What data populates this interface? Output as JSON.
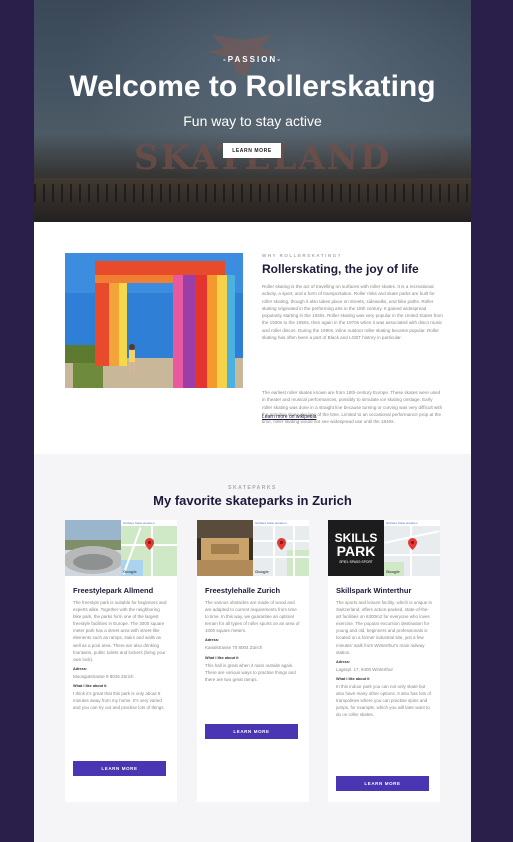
{
  "hero": {
    "kicker": "-PASSION-",
    "title": "Welcome to Rollerskating",
    "subtitle": "Fun way to stay active",
    "button_label": "LEARN MORE",
    "sign_text": "SKATELAND"
  },
  "about": {
    "kicker": "WHY ROLLERSKATING?",
    "title": "Rollerskating, the joy of life",
    "paragraph1": "Roller skating is the act of travelling on surfaces with roller skates. It is a recreational activity, a sport, and a form of transportation. Roller rinks and skate parks are built for roller skating, though it also takes place on streets, sidewalks, and bike paths. Roller skating originated in the performing arts in the 18th century. It gained widespread popularity starting in the 1930s. Roller skating was very popular in the United States from the 1930s to the 1950s, then again in the 1970s when it was associated with disco music and roller discos. During the 1990s, inline outdoor roller skating became popular. Roller skating has often been a part of Black and LGBT history in particular.",
    "paragraph2": "The earliest roller skates known are from 18th-century Europe. These skates were used in theater and musical performances, possibly to simulate ice skating onstage. Early roller skating was done in a straight line because turning or curving was very difficult with the primitive skate designs of the time. Limited to an occasional performance prop at the time, roller skating would not see widespread use until the 1840s.",
    "link": "Learn more on wikipedia"
  },
  "skateparks": {
    "kicker": "SKATEPARKS",
    "title": "My favorite skateparks in Zurich",
    "map_bar_text": "Größere Karte ansehen",
    "map_logo": "Google",
    "cards": [
      {
        "title": "Freestylepark Allmend",
        "description": "The freestyle park is suitable for beginners and experts alike. Together with the neighboring bike park, the parks form one of the largest freestyle facilities in Europe. The 3000 square meter park has a street area with street-like elements such as ramps, stairs and walls as well as a pool area. There are also drinking fountains, public toilets and lockers (bring your own lock).",
        "address_label": "Adress:",
        "address": "Moosgutstrasse 9 8045 Zürich",
        "like_label": "What I like about it",
        "like_text": "I think it's great that this park is only about 5 minutes away from my home. It's very varied and you can try out and practise lots of things.",
        "button_label": "LEARN MORE",
        "photo": "skatepark-bowl"
      },
      {
        "title": "Freestylehalle Zurich",
        "description": "The various obstacles are made of wood and are adapted to current requirements from time to time. In this way, we guarantee an optimal terrain for all types of roller sports on an area of 1000 square meters.",
        "address_label": "Adress:",
        "address": "Kanalstrasse 70 8004 Zürich",
        "like_label": "What I like about it",
        "like_text": "This hall is great when it rains outside again. There are various ways to practise things and there are two great ramps.",
        "button_label": "LEARN MORE",
        "photo": "indoor-hall"
      },
      {
        "title": "Skillspark Winterthur",
        "description": "The sports and leisure facility, which is unique in Switzerland, offers action-packed, state-of-the-art facilities on 6300m2 for everyone who loves exercise. The popular excursion destination for young and old, beginners and professionals is located on a former industrial site, just a few minutes' walk from Winterthur's main railway station.",
        "address_label": "Adress:",
        "address": "Lagerpl. 17, 8400 Winterthur",
        "like_label": "What I like about it",
        "like_text": "In this indoor park you can not only skate but also have many other options. It also has lots of trampolines where you can practise spins and jumps, for example, which you will later want to do on roller skates.",
        "button_label": "LEARN MORE",
        "logo_line1": "SKILLS",
        "logo_line2": "PARK",
        "logo_tagline": "SPIEL·SPASS·SPORT",
        "photo": "skillspark-logo"
      }
    ]
  },
  "colors": {
    "outer_background": "#2a1e4a",
    "accent_button": "#4a35b3",
    "heading": "#1d1a3a",
    "body_text": "#888888",
    "section_gray": "#f5f5f7"
  }
}
